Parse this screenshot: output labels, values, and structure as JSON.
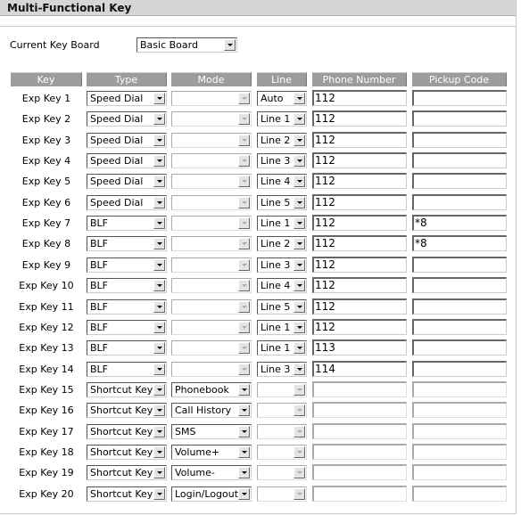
{
  "title": "Multi-Functional Key",
  "keyboard": {
    "label": "Current Key Board",
    "value": "Basic Board"
  },
  "headers": [
    "Key",
    "Type",
    "Mode",
    "Line",
    "Phone Number",
    "Pickup Code"
  ],
  "rows": [
    {
      "key": "Exp Key 1",
      "type": "Speed Dial",
      "mode": "",
      "line": "Auto",
      "phone": "112",
      "pickup": ""
    },
    {
      "key": "Exp Key 2",
      "type": "Speed Dial",
      "mode": "",
      "line": "Line 1",
      "phone": "112",
      "pickup": ""
    },
    {
      "key": "Exp Key 3",
      "type": "Speed Dial",
      "mode": "",
      "line": "Line 2",
      "phone": "112",
      "pickup": ""
    },
    {
      "key": "Exp Key 4",
      "type": "Speed Dial",
      "mode": "",
      "line": "Line 3",
      "phone": "112",
      "pickup": ""
    },
    {
      "key": "Exp Key 5",
      "type": "Speed Dial",
      "mode": "",
      "line": "Line 4",
      "phone": "112",
      "pickup": ""
    },
    {
      "key": "Exp Key 6",
      "type": "Speed Dial",
      "mode": "",
      "line": "Line 5",
      "phone": "112",
      "pickup": ""
    },
    {
      "key": "Exp Key 7",
      "type": "BLF",
      "mode": "",
      "line": "Line 1",
      "phone": "112",
      "pickup": "*8"
    },
    {
      "key": "Exp Key 8",
      "type": "BLF",
      "mode": "",
      "line": "Line 2",
      "phone": "112",
      "pickup": "*8"
    },
    {
      "key": "Exp Key 9",
      "type": "BLF",
      "mode": "",
      "line": "Line 3",
      "phone": "112",
      "pickup": ""
    },
    {
      "key": "Exp Key 10",
      "type": "BLF",
      "mode": "",
      "line": "Line 4",
      "phone": "112",
      "pickup": ""
    },
    {
      "key": "Exp Key 11",
      "type": "BLF",
      "mode": "",
      "line": "Line 5",
      "phone": "112",
      "pickup": ""
    },
    {
      "key": "Exp Key 12",
      "type": "BLF",
      "mode": "",
      "line": "Line 1",
      "phone": "112",
      "pickup": ""
    },
    {
      "key": "Exp Key 13",
      "type": "BLF",
      "mode": "",
      "line": "Line 1",
      "phone": "113",
      "pickup": ""
    },
    {
      "key": "Exp Key 14",
      "type": "BLF",
      "mode": "",
      "line": "Line 3",
      "phone": "114",
      "pickup": ""
    },
    {
      "key": "Exp Key 15",
      "type": "Shortcut Key",
      "mode": "Phonebook",
      "line": "",
      "phone": "",
      "pickup": ""
    },
    {
      "key": "Exp Key 16",
      "type": "Shortcut Key",
      "mode": "Call History",
      "line": "",
      "phone": "",
      "pickup": ""
    },
    {
      "key": "Exp Key 17",
      "type": "Shortcut Key",
      "mode": "SMS",
      "line": "",
      "phone": "",
      "pickup": ""
    },
    {
      "key": "Exp Key 18",
      "type": "Shortcut Key",
      "mode": "Volume+",
      "line": "",
      "phone": "",
      "pickup": ""
    },
    {
      "key": "Exp Key 19",
      "type": "Shortcut Key",
      "mode": "Volume-",
      "line": "",
      "phone": "",
      "pickup": ""
    },
    {
      "key": "Exp Key 20",
      "type": "Shortcut Key",
      "mode": "Login/Logout",
      "line": "",
      "phone": "",
      "pickup": ""
    }
  ]
}
